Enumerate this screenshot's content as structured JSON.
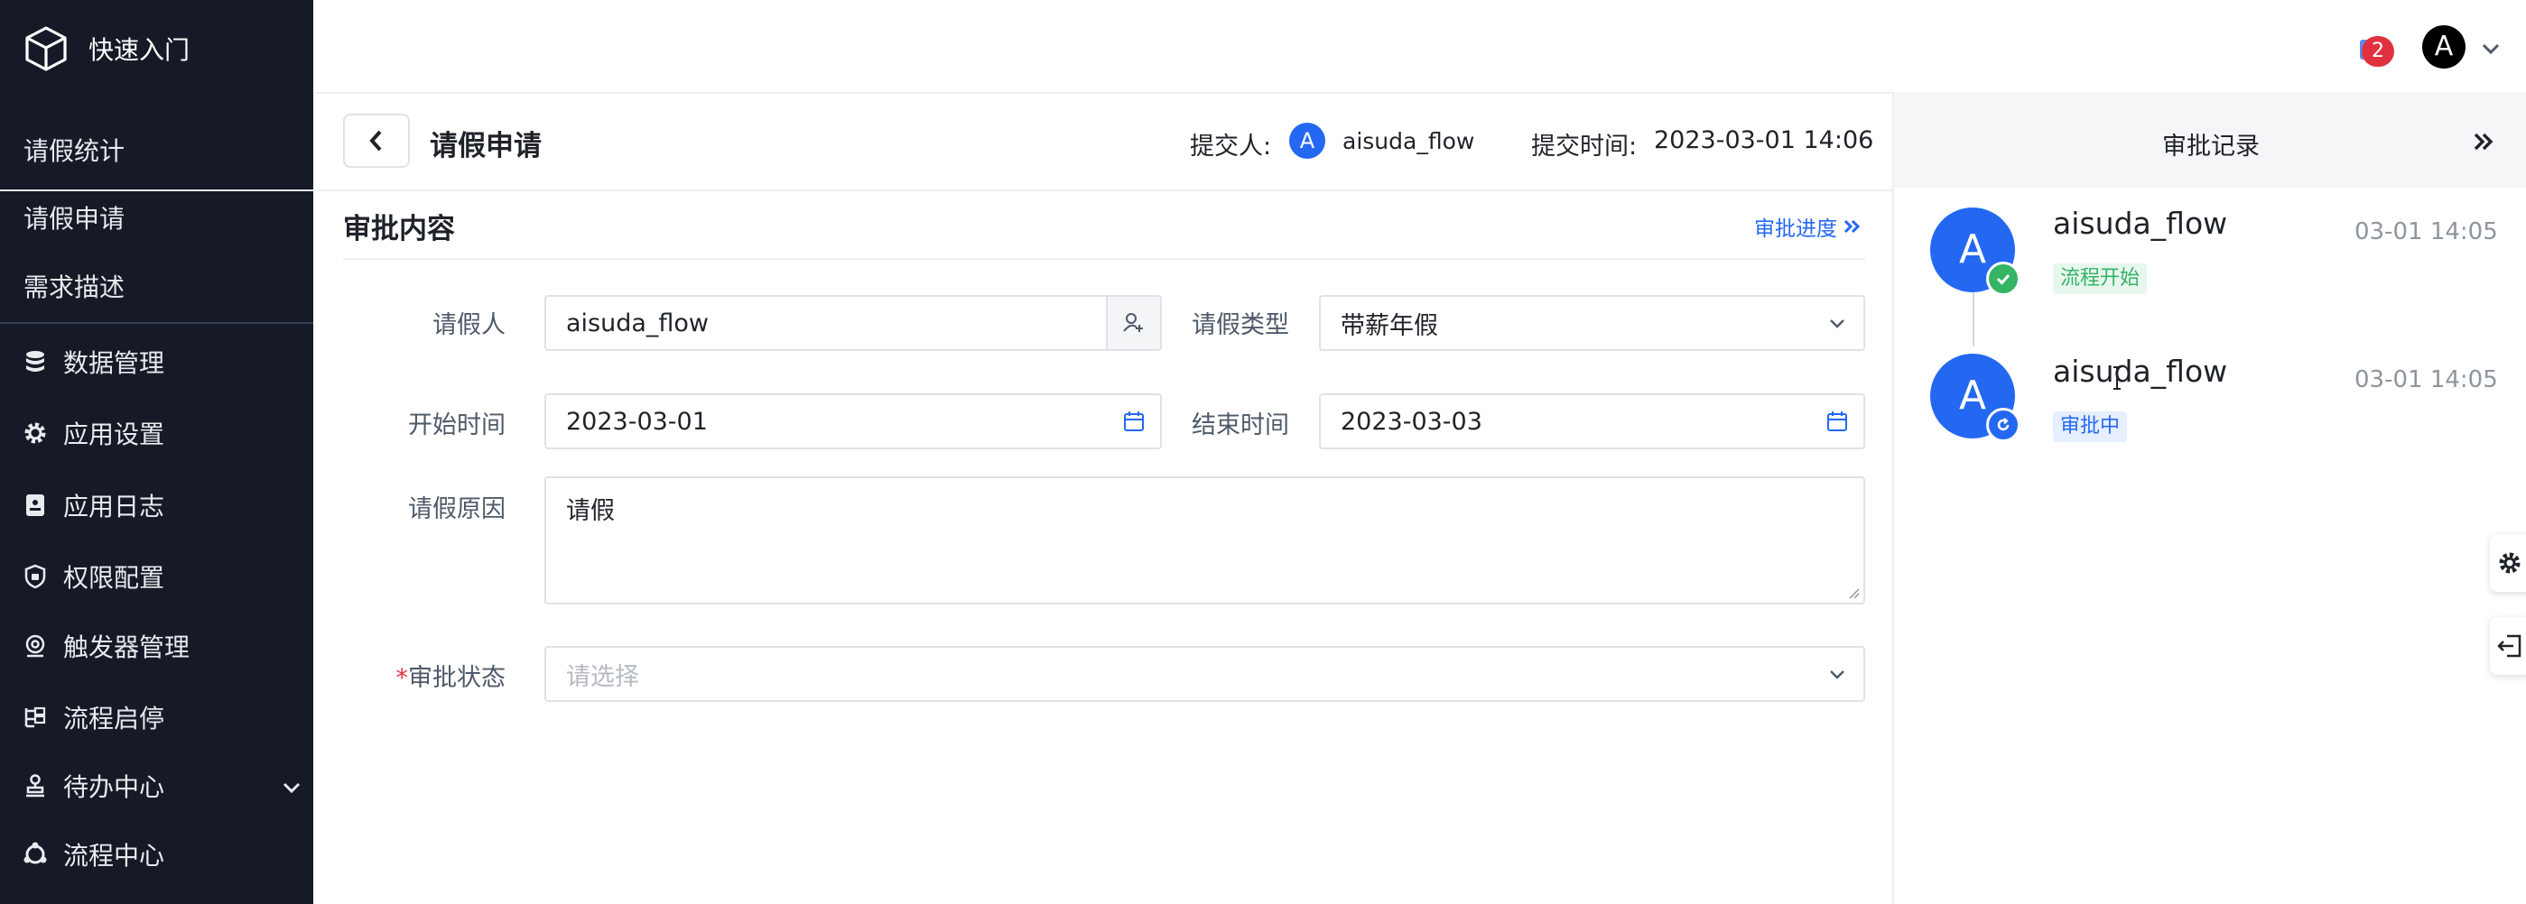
{
  "sidebar": {
    "brand": "快速入门",
    "plain_items": [
      {
        "label": "请假统计"
      },
      {
        "label": "请假申请"
      },
      {
        "label": "需求描述"
      }
    ],
    "items": [
      {
        "label": "数据管理",
        "icon": "database-icon"
      },
      {
        "label": "应用设置",
        "icon": "gear-icon"
      },
      {
        "label": "应用日志",
        "icon": "log-icon"
      },
      {
        "label": "权限配置",
        "icon": "shield-icon"
      },
      {
        "label": "触发器管理",
        "icon": "trigger-icon"
      },
      {
        "label": "流程启停",
        "icon": "flow-toggle-icon"
      },
      {
        "label": "待办中心",
        "icon": "stamp-icon",
        "expandable": true
      },
      {
        "label": "流程中心",
        "icon": "flow-center-icon"
      }
    ]
  },
  "header": {
    "notification_count": "2",
    "user_initial": "A"
  },
  "form": {
    "title": "请假申请",
    "submitter_label": "提交人:",
    "submitter_initial": "A",
    "submitter_name": "aisuda_flow",
    "submit_time_label": "提交时间:",
    "submit_time": "2023-03-01 14:06",
    "section_title": "审批内容",
    "progress_link": "审批进度",
    "fields": {
      "applicant": {
        "label": "请假人",
        "value": "aisuda_flow"
      },
      "leave_type": {
        "label": "请假类型",
        "value": "带薪年假"
      },
      "start_time": {
        "label": "开始时间",
        "value": "2023-03-01"
      },
      "end_time": {
        "label": "结束时间",
        "value": "2023-03-03"
      },
      "reason": {
        "label": "请假原因",
        "value": "请假"
      },
      "approval_status": {
        "label": "审批状态",
        "required_mark": "*",
        "placeholder": "请选择"
      }
    }
  },
  "approval_panel": {
    "title": "审批记录",
    "records": [
      {
        "initial": "A",
        "name": "aisuda_flow",
        "time": "03-01 14:05",
        "tag": "流程开始",
        "status": "completed"
      },
      {
        "initial": "A",
        "name": "aisuda_flow",
        "time": "03-01 14:05",
        "tag": "审批中",
        "status": "in-progress"
      }
    ]
  },
  "colors": {
    "sidebar_bg": "#151a26",
    "primary": "#2468f2",
    "success": "#34b464",
    "danger": "#e0323e"
  }
}
